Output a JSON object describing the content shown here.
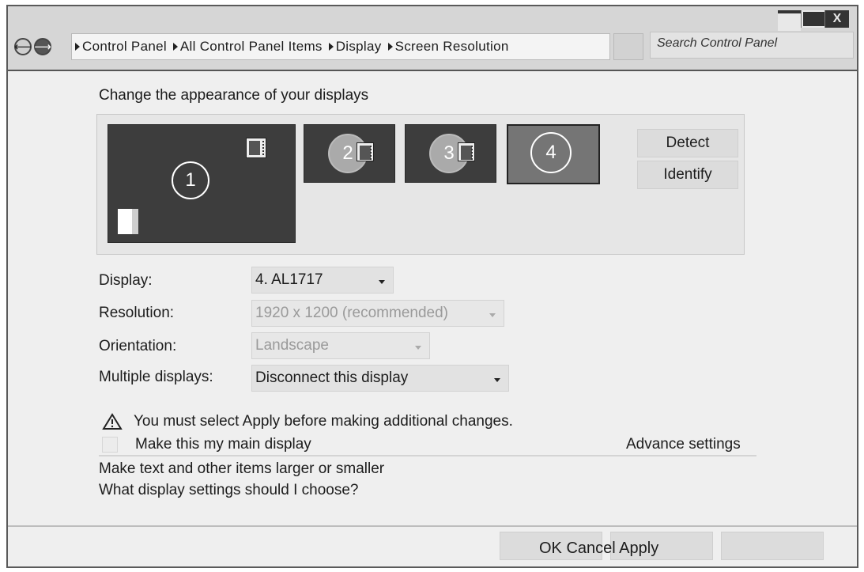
{
  "breadcrumb": [
    "Control Panel",
    "All Control Panel Items",
    "Display",
    "Screen Resolution"
  ],
  "search": {
    "placeholder": "Search Control Panel"
  },
  "window_controls": {
    "close": "X"
  },
  "nav": {
    "back": "⟵",
    "forward": "⟶"
  },
  "heading": "Change the appearance of your displays",
  "monitors": [
    {
      "number": "1"
    },
    {
      "number": "2"
    },
    {
      "number": "3"
    },
    {
      "number": "4"
    }
  ],
  "side_buttons": {
    "detect": "Detect",
    "identify": "Identify"
  },
  "settings": {
    "display": {
      "label": "Display:",
      "value": "4. AL1717"
    },
    "resolution": {
      "label": "Resolution:",
      "value": "1920 x 1200 (recommended)"
    },
    "orientation": {
      "label": "Orientation:",
      "value": "Landscape"
    },
    "multiple": {
      "label": "Multiple displays:",
      "value": "Disconnect this display"
    }
  },
  "warning": "You must select Apply before making additional changes.",
  "main_display_label": "Make this my main display",
  "advanced": "Advance settings",
  "links": {
    "text_size": "Make text and other items larger or smaller",
    "which_settings": "What display settings should I choose?"
  },
  "footer": {
    "buttons_text": "OK Cancel Apply"
  }
}
